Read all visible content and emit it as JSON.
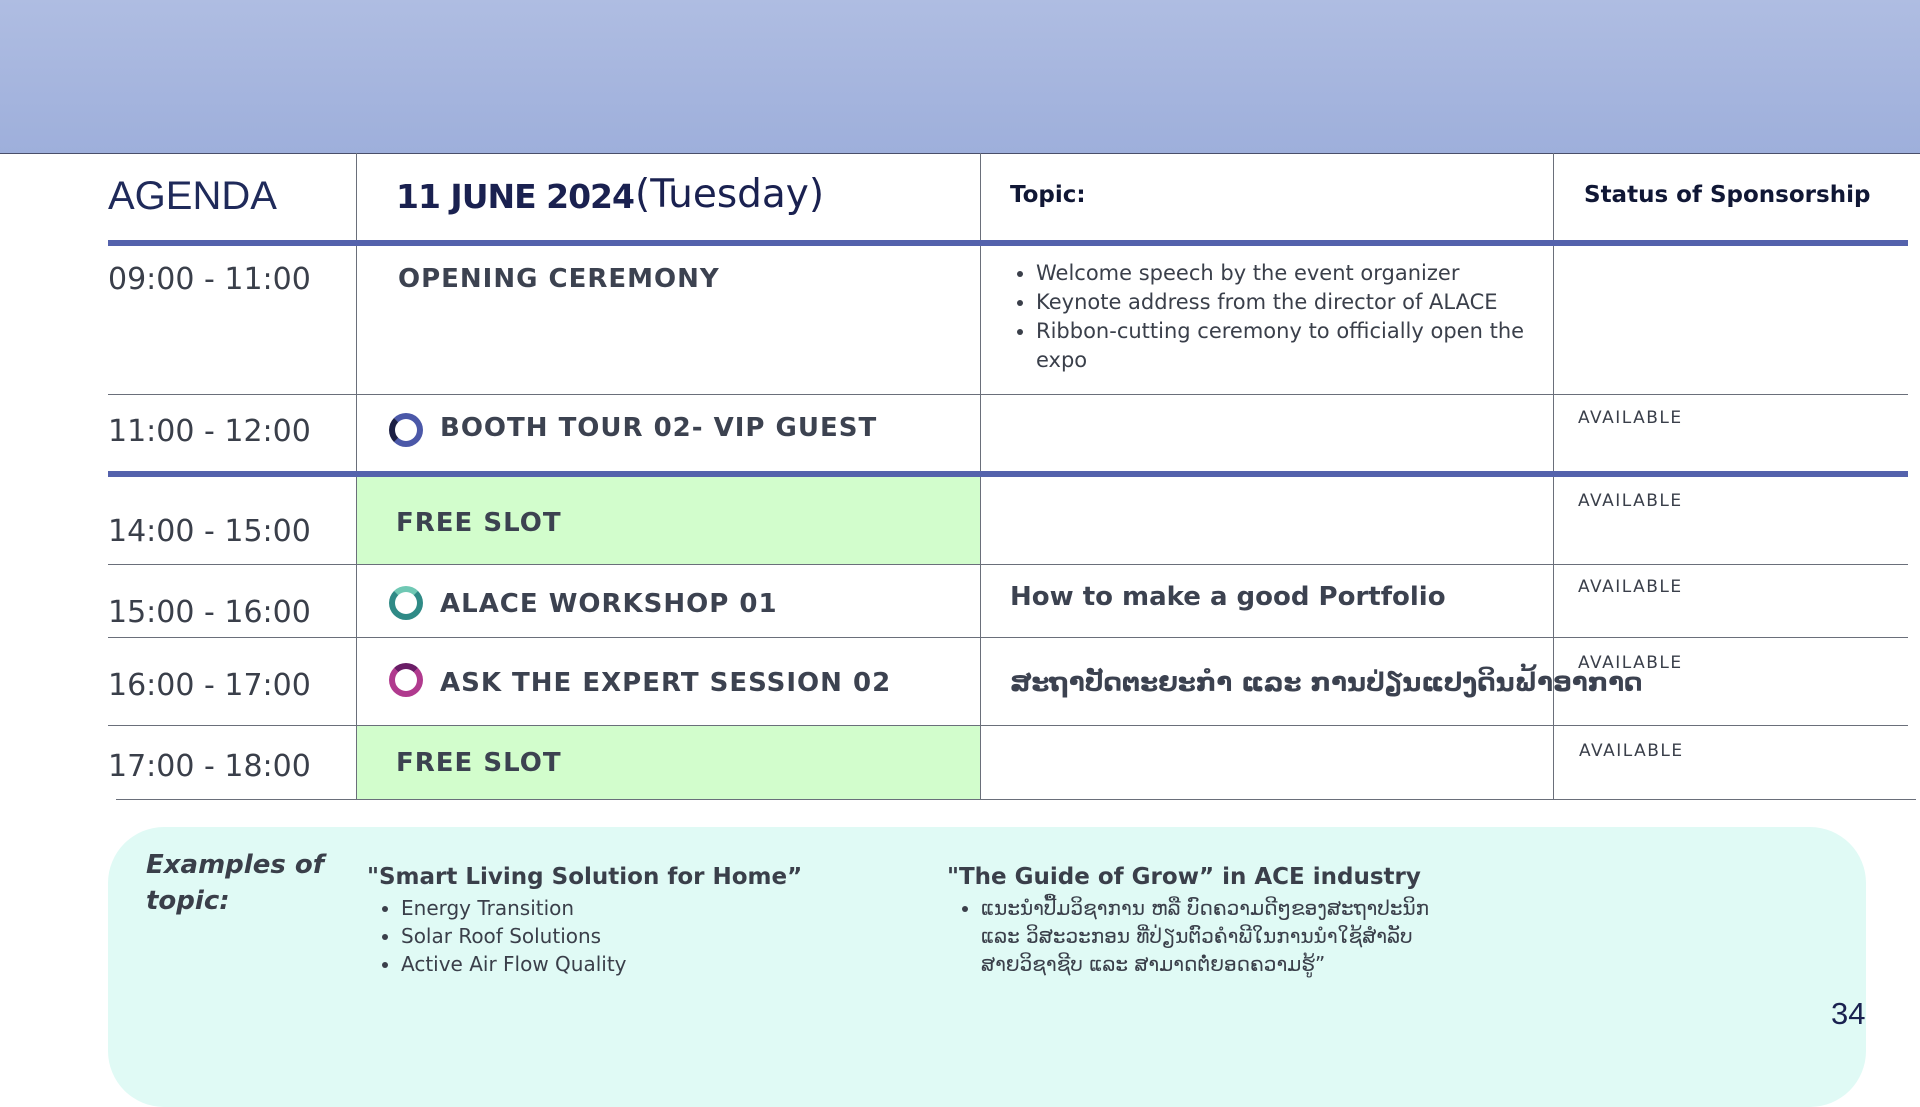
{
  "header": {
    "agenda_title": "AGENDA",
    "date": "11 JUNE 2024",
    "day": "(Tuesday)",
    "topic_label": "Topic:",
    "status_label": "Status of Sponsorship"
  },
  "rows": [
    {
      "time": "09:00 - 11:00",
      "event": "OPENING CEREMONY",
      "topics": [
        "Welcome speech by the event organizer",
        "Keynote address from the director of ALACE",
        "Ribbon-cutting ceremony to officially open the expo"
      ],
      "status": ""
    },
    {
      "time": "11:00 - 12:00",
      "event": "BOOTH TOUR 02- VIP GUEST",
      "icon": "ring-icon",
      "ring_color": "#4b58a8",
      "topic": "",
      "status": "AVAILABLE"
    },
    {
      "time": "14:00 - 15:00",
      "event": "FREE SLOT",
      "topic": "",
      "status": "AVAILABLE",
      "highlight": "#d2fdcc"
    },
    {
      "time": "15:00 - 16:00",
      "event": "ALACE WORKSHOP 01",
      "icon": "ring-icon",
      "ring_color": "#2f8a86",
      "topic": "How to make a good Portfolio",
      "status": "AVAILABLE"
    },
    {
      "time": "16:00 - 17:00",
      "event": "ASK THE EXPERT SESSION 02",
      "icon": "ring-icon",
      "ring_color": "#b03a8e",
      "topic": "ສະຖາປັດຕະຍະກຳ ແລະ ການປ່ຽນແປງດິນຟ້າອາກາດ",
      "status": "AVAILABLE"
    },
    {
      "time": "17:00 - 18:00",
      "event": "FREE SLOT",
      "topic": "",
      "status": "AVAILABLE",
      "highlight": "#d2fdcc"
    }
  ],
  "examples": {
    "label": "Examples of topic:",
    "col1": {
      "title": "\"Smart Living Solution for Home”",
      "items": [
        "Energy Transition",
        "Solar Roof Solutions",
        "Active Air Flow Quality"
      ]
    },
    "col2": {
      "title": "\"The Guide of Grow” in ACE industry",
      "items": [
        "ແນະນຳປື້ມວິຊາການ ຫລື ບົດຄວາມດີໆຂອງສະຖາປະນິກ ແລະ ວິສະວະກອນ ທີ່ປ່ຽນຕົວຄຳພີໃນການນຳໃຊ້ສຳລັບສາຍວິຊາຊີບ ແລະ ສາມາດຕໍ່ຍອດຄວາມຮູ້”"
      ]
    }
  },
  "page_number": "34",
  "colors": {
    "band": "#a3b3dd",
    "accent_line": "#5462ac",
    "free_slot": "#d2fdcc",
    "examples_bg": "#e0faf5"
  }
}
